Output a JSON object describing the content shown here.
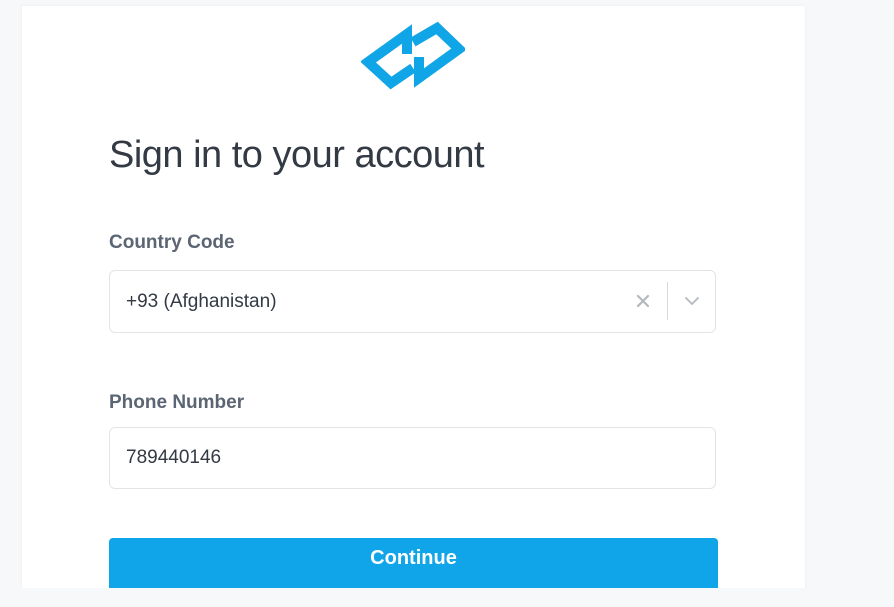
{
  "signin": {
    "title": "Sign in to your account",
    "country_code_label": "Country Code",
    "country_code_value": "+93 (Afghanistan)",
    "phone_number_label": "Phone Number",
    "phone_number_value": "789440146",
    "continue_label": "Continue"
  },
  "icons": {
    "logo": "brand-logo-icon",
    "clear": "close-icon",
    "dropdown": "chevron-down-icon"
  },
  "colors": {
    "accent": "#0fa5e8",
    "title_text": "#333a44",
    "label_text": "#5b6573",
    "field_border": "#e2e5e8"
  }
}
